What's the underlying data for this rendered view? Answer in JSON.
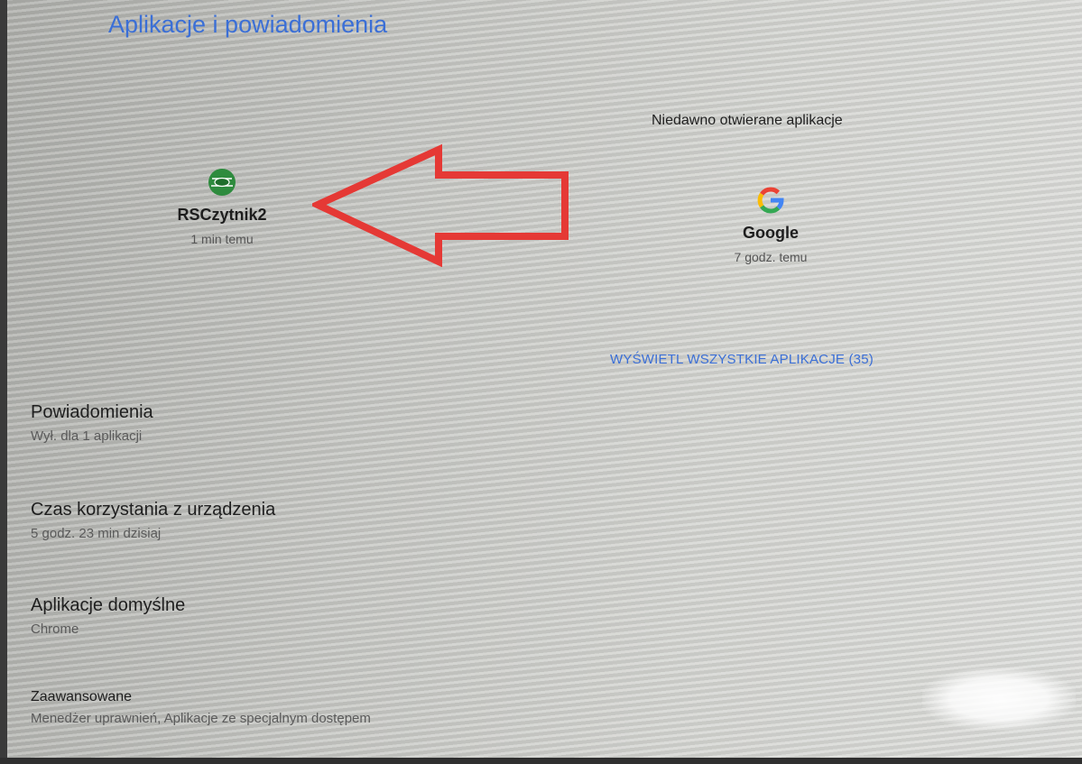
{
  "header": {
    "title": "Aplikacje i powiadomienia"
  },
  "recent": {
    "header": "Niedawno otwierane aplikacje",
    "apps": [
      {
        "name": "RSCzytnik2",
        "time": "1 min temu",
        "icon": "rscz-app-icon",
        "color": "#2e8b3e"
      },
      {
        "name": "Google",
        "time": "7 godz. temu",
        "icon": "google-g-icon"
      }
    ],
    "see_all": "WYŚWIETL WSZYSTKIE APLIKACJE (35)"
  },
  "settings": [
    {
      "title": "Powiadomienia",
      "subtitle": "Wył. dla 1 aplikacji"
    },
    {
      "title": "Czas korzystania z urządzenia",
      "subtitle": "5 godz. 23 min dzisiaj"
    },
    {
      "title": "Aplikacje domyślne",
      "subtitle": "Chrome"
    },
    {
      "title": "Zaawansowane",
      "subtitle": "Menedżer uprawnień, Aplikacje ze specjalnym dostępem"
    }
  ],
  "annotation": {
    "type": "red-arrow-pointing-left",
    "color": "#e53935"
  },
  "colors": {
    "accent": "#3b6fd6",
    "text": "#1f1f1f"
  }
}
